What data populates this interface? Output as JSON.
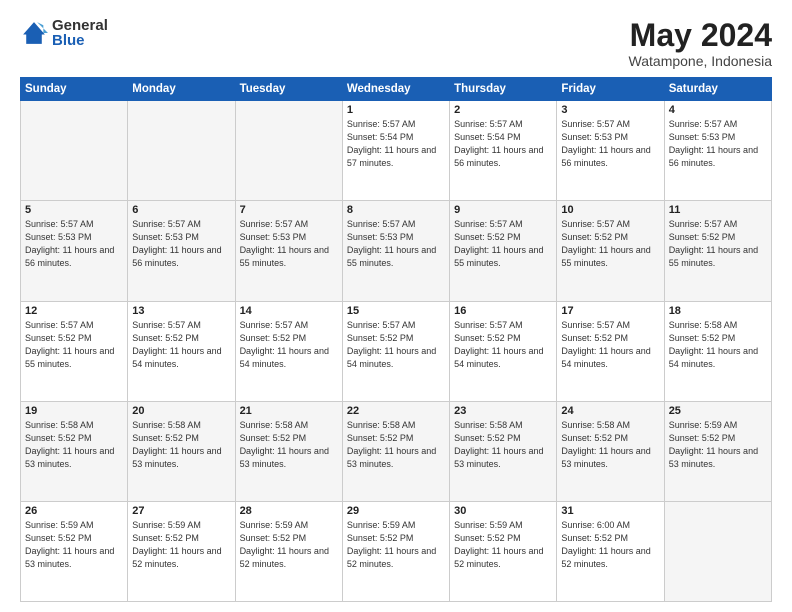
{
  "header": {
    "logo_general": "General",
    "logo_blue": "Blue",
    "title": "May 2024",
    "location": "Watampone, Indonesia"
  },
  "weekdays": [
    "Sunday",
    "Monday",
    "Tuesday",
    "Wednesday",
    "Thursday",
    "Friday",
    "Saturday"
  ],
  "weeks": [
    [
      {
        "day": "",
        "sunrise": "",
        "sunset": "",
        "daylight": ""
      },
      {
        "day": "",
        "sunrise": "",
        "sunset": "",
        "daylight": ""
      },
      {
        "day": "",
        "sunrise": "",
        "sunset": "",
        "daylight": ""
      },
      {
        "day": "1",
        "sunrise": "Sunrise: 5:57 AM",
        "sunset": "Sunset: 5:54 PM",
        "daylight": "Daylight: 11 hours and 57 minutes."
      },
      {
        "day": "2",
        "sunrise": "Sunrise: 5:57 AM",
        "sunset": "Sunset: 5:54 PM",
        "daylight": "Daylight: 11 hours and 56 minutes."
      },
      {
        "day": "3",
        "sunrise": "Sunrise: 5:57 AM",
        "sunset": "Sunset: 5:53 PM",
        "daylight": "Daylight: 11 hours and 56 minutes."
      },
      {
        "day": "4",
        "sunrise": "Sunrise: 5:57 AM",
        "sunset": "Sunset: 5:53 PM",
        "daylight": "Daylight: 11 hours and 56 minutes."
      }
    ],
    [
      {
        "day": "5",
        "sunrise": "Sunrise: 5:57 AM",
        "sunset": "Sunset: 5:53 PM",
        "daylight": "Daylight: 11 hours and 56 minutes."
      },
      {
        "day": "6",
        "sunrise": "Sunrise: 5:57 AM",
        "sunset": "Sunset: 5:53 PM",
        "daylight": "Daylight: 11 hours and 56 minutes."
      },
      {
        "day": "7",
        "sunrise": "Sunrise: 5:57 AM",
        "sunset": "Sunset: 5:53 PM",
        "daylight": "Daylight: 11 hours and 55 minutes."
      },
      {
        "day": "8",
        "sunrise": "Sunrise: 5:57 AM",
        "sunset": "Sunset: 5:53 PM",
        "daylight": "Daylight: 11 hours and 55 minutes."
      },
      {
        "day": "9",
        "sunrise": "Sunrise: 5:57 AM",
        "sunset": "Sunset: 5:52 PM",
        "daylight": "Daylight: 11 hours and 55 minutes."
      },
      {
        "day": "10",
        "sunrise": "Sunrise: 5:57 AM",
        "sunset": "Sunset: 5:52 PM",
        "daylight": "Daylight: 11 hours and 55 minutes."
      },
      {
        "day": "11",
        "sunrise": "Sunrise: 5:57 AM",
        "sunset": "Sunset: 5:52 PM",
        "daylight": "Daylight: 11 hours and 55 minutes."
      }
    ],
    [
      {
        "day": "12",
        "sunrise": "Sunrise: 5:57 AM",
        "sunset": "Sunset: 5:52 PM",
        "daylight": "Daylight: 11 hours and 55 minutes."
      },
      {
        "day": "13",
        "sunrise": "Sunrise: 5:57 AM",
        "sunset": "Sunset: 5:52 PM",
        "daylight": "Daylight: 11 hours and 54 minutes."
      },
      {
        "day": "14",
        "sunrise": "Sunrise: 5:57 AM",
        "sunset": "Sunset: 5:52 PM",
        "daylight": "Daylight: 11 hours and 54 minutes."
      },
      {
        "day": "15",
        "sunrise": "Sunrise: 5:57 AM",
        "sunset": "Sunset: 5:52 PM",
        "daylight": "Daylight: 11 hours and 54 minutes."
      },
      {
        "day": "16",
        "sunrise": "Sunrise: 5:57 AM",
        "sunset": "Sunset: 5:52 PM",
        "daylight": "Daylight: 11 hours and 54 minutes."
      },
      {
        "day": "17",
        "sunrise": "Sunrise: 5:57 AM",
        "sunset": "Sunset: 5:52 PM",
        "daylight": "Daylight: 11 hours and 54 minutes."
      },
      {
        "day": "18",
        "sunrise": "Sunrise: 5:58 AM",
        "sunset": "Sunset: 5:52 PM",
        "daylight": "Daylight: 11 hours and 54 minutes."
      }
    ],
    [
      {
        "day": "19",
        "sunrise": "Sunrise: 5:58 AM",
        "sunset": "Sunset: 5:52 PM",
        "daylight": "Daylight: 11 hours and 53 minutes."
      },
      {
        "day": "20",
        "sunrise": "Sunrise: 5:58 AM",
        "sunset": "Sunset: 5:52 PM",
        "daylight": "Daylight: 11 hours and 53 minutes."
      },
      {
        "day": "21",
        "sunrise": "Sunrise: 5:58 AM",
        "sunset": "Sunset: 5:52 PM",
        "daylight": "Daylight: 11 hours and 53 minutes."
      },
      {
        "day": "22",
        "sunrise": "Sunrise: 5:58 AM",
        "sunset": "Sunset: 5:52 PM",
        "daylight": "Daylight: 11 hours and 53 minutes."
      },
      {
        "day": "23",
        "sunrise": "Sunrise: 5:58 AM",
        "sunset": "Sunset: 5:52 PM",
        "daylight": "Daylight: 11 hours and 53 minutes."
      },
      {
        "day": "24",
        "sunrise": "Sunrise: 5:58 AM",
        "sunset": "Sunset: 5:52 PM",
        "daylight": "Daylight: 11 hours and 53 minutes."
      },
      {
        "day": "25",
        "sunrise": "Sunrise: 5:59 AM",
        "sunset": "Sunset: 5:52 PM",
        "daylight": "Daylight: 11 hours and 53 minutes."
      }
    ],
    [
      {
        "day": "26",
        "sunrise": "Sunrise: 5:59 AM",
        "sunset": "Sunset: 5:52 PM",
        "daylight": "Daylight: 11 hours and 53 minutes."
      },
      {
        "day": "27",
        "sunrise": "Sunrise: 5:59 AM",
        "sunset": "Sunset: 5:52 PM",
        "daylight": "Daylight: 11 hours and 52 minutes."
      },
      {
        "day": "28",
        "sunrise": "Sunrise: 5:59 AM",
        "sunset": "Sunset: 5:52 PM",
        "daylight": "Daylight: 11 hours and 52 minutes."
      },
      {
        "day": "29",
        "sunrise": "Sunrise: 5:59 AM",
        "sunset": "Sunset: 5:52 PM",
        "daylight": "Daylight: 11 hours and 52 minutes."
      },
      {
        "day": "30",
        "sunrise": "Sunrise: 5:59 AM",
        "sunset": "Sunset: 5:52 PM",
        "daylight": "Daylight: 11 hours and 52 minutes."
      },
      {
        "day": "31",
        "sunrise": "Sunrise: 6:00 AM",
        "sunset": "Sunset: 5:52 PM",
        "daylight": "Daylight: 11 hours and 52 minutes."
      },
      {
        "day": "",
        "sunrise": "",
        "sunset": "",
        "daylight": ""
      }
    ]
  ]
}
